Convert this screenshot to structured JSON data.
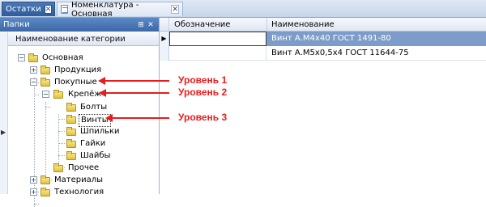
{
  "tabs": [
    {
      "label": "Остатки",
      "active": true
    },
    {
      "label": "Номенклатура - Основная",
      "active": false
    }
  ],
  "folders_panel": {
    "title": "Папки",
    "pin_glyph": "⊞",
    "close_glyph": "✕",
    "column_header": "Наименование категории",
    "tree": [
      {
        "label": "Основная",
        "expander": "−"
      },
      {
        "label": "Продукция",
        "expander": "+"
      },
      {
        "label": "Покупные",
        "expander": "−"
      },
      {
        "label": "Крепёж",
        "expander": "−"
      },
      {
        "label": "Болты"
      },
      {
        "label": "Винты",
        "selected": true
      },
      {
        "label": "Шпильки"
      },
      {
        "label": "Гайки"
      },
      {
        "label": "Шайбы"
      },
      {
        "label": "Прочее"
      },
      {
        "label": "Материалы",
        "expander": "+"
      },
      {
        "label": "Технология",
        "expander": "+"
      }
    ]
  },
  "grid": {
    "columns": [
      "Обозначение",
      "Наименование"
    ],
    "rows": [
      {
        "designation": "",
        "name": "Винт А.М4х40 ГОСТ 1491-80",
        "selected": true
      },
      {
        "designation": "",
        "name": "Винт А.М5х0,5х4 ГОСТ 11644-75",
        "selected": false
      }
    ]
  },
  "annotations": [
    {
      "label": "Уровень 1"
    },
    {
      "label": "Уровень 2"
    },
    {
      "label": "Уровень 3"
    }
  ],
  "colors": {
    "annotation": "#e81c1c",
    "active_tab": "#2f5c9c",
    "selected_row": "#7d9cc9",
    "panel_header": "#3c68a8"
  },
  "icons": {
    "tab_close": "✕",
    "row_pointer": "▶"
  }
}
